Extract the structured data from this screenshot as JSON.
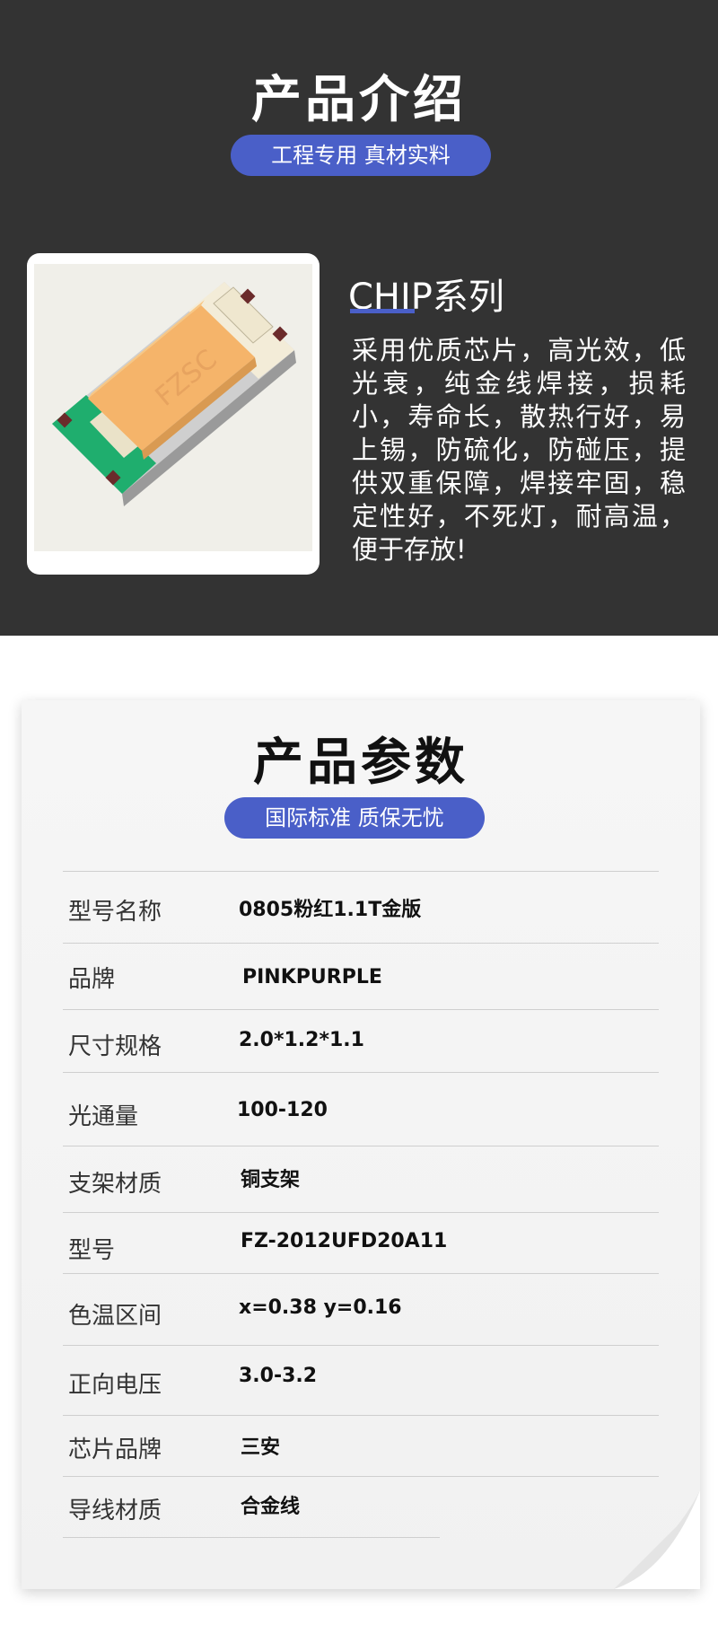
{
  "intro": {
    "title": "产品介绍",
    "badge": "工程专用 真材实料",
    "series_title": "CHIP系列",
    "series_description": "采用优质芯片，高光效，低光衰，纯金线焊接，损耗小，寿命长，散热行好，易上锡，防硫化，防碰压，提供双重保障，焊接牢固，稳定性好，不死灯，耐高温，便于存放!",
    "chip_marking": "FZSC"
  },
  "params": {
    "title": "产品参数",
    "badge": "国际标准 质保无忧",
    "rows": [
      {
        "label": "型号名称",
        "value": "0805粉红1.1T金版"
      },
      {
        "label": "品牌",
        "value": "PINKPURPLE"
      },
      {
        "label": "尺寸规格",
        "value": "2.0*1.2*1.1"
      },
      {
        "label": "光通量",
        "value": "100-120"
      },
      {
        "label": "支架材质",
        "value": "铜支架"
      },
      {
        "label": "型号",
        "value": "FZ-2012UFD20A11"
      },
      {
        "label": "色温区间",
        "value": "x=0.38 y=0.16"
      },
      {
        "label": "正向电压",
        "value": "3.0-3.2"
      },
      {
        "label": "芯片品牌",
        "value": "三安"
      },
      {
        "label": "导线材质",
        "value": "合金线"
      }
    ]
  },
  "colors": {
    "dark_background": "#333333",
    "accent_blue": "#4a5fc8",
    "chip_orange": "#f5b46a",
    "chip_green": "#1fae6e"
  }
}
